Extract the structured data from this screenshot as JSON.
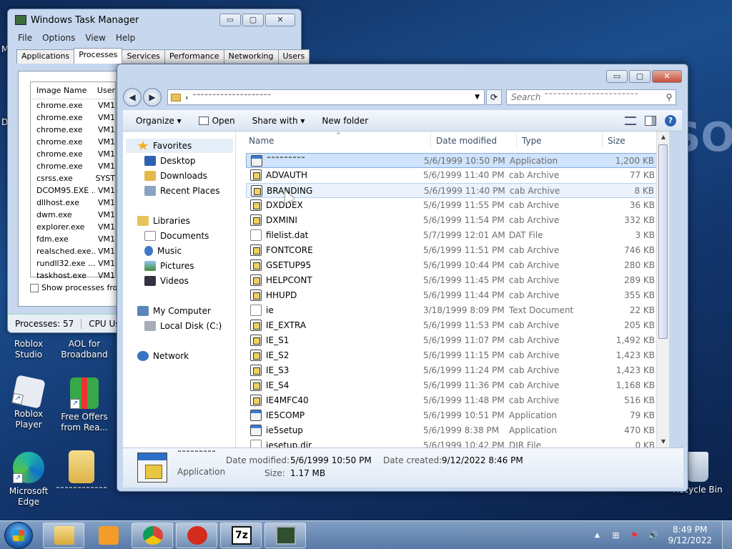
{
  "desktop": {
    "deco_text": "SO",
    "partial_left_1": "M",
    "partial_left_2": "D",
    "icons": [
      {
        "label": "Roblox Studio"
      },
      {
        "label": "AOL for Broadband"
      },
      {
        "label": "Roblox Player"
      },
      {
        "label": "Free Offers from Rea..."
      },
      {
        "label": "Microsoft Edge"
      },
      {
        "label": "˜˜˜˜˜˜˜˜˜˜˜˜"
      },
      {
        "label": "Recycle Bin"
      }
    ]
  },
  "taskmgr": {
    "title": "Windows Task Manager",
    "btn_min": "▭",
    "btn_max": "▢",
    "btn_close": "✕",
    "menu": [
      "File",
      "Options",
      "View",
      "Help"
    ],
    "tabs": [
      "Applications",
      "Processes",
      "Services",
      "Performance",
      "Networking",
      "Users"
    ],
    "active_tab": 1,
    "col_image": "Image Name",
    "col_user": "User",
    "rows": [
      {
        "name": "chrome.exe",
        "user": "VM1"
      },
      {
        "name": "chrome.exe",
        "user": "VM1"
      },
      {
        "name": "chrome.exe",
        "user": "VM1"
      },
      {
        "name": "chrome.exe",
        "user": "VM1"
      },
      {
        "name": "chrome.exe",
        "user": "VM1"
      },
      {
        "name": "chrome.exe",
        "user": "VM1"
      },
      {
        "name": "csrss.exe",
        "user": "SYST"
      },
      {
        "name": "DCOM95.EXE ...",
        "user": "VM1"
      },
      {
        "name": "dllhost.exe",
        "user": "VM1"
      },
      {
        "name": "dwm.exe",
        "user": "VM1"
      },
      {
        "name": "explorer.exe",
        "user": "VM1"
      },
      {
        "name": "fdm.exe",
        "user": "VM1"
      },
      {
        "name": "realsched.exe...",
        "user": "VM1"
      },
      {
        "name": "rundll32.exe ...",
        "user": "VM1"
      },
      {
        "name": "taskhost.exe",
        "user": "VM1"
      }
    ],
    "show_all": "Show processes from",
    "status_processes": "Processes: 57",
    "status_cpu": "CPU Us"
  },
  "explorer": {
    "btn_min": "▭",
    "btn_max": "▢",
    "btn_close": "✕",
    "address_path": "˜˜˜˜˜˜˜˜˜˜˜˜˜˜˜˜˜˜˜˜",
    "address_arrow": "›",
    "address_dropdown": "▼",
    "refresh": "⟳",
    "search_placeholder": "Search ˜˜˜˜˜˜˜˜˜˜˜˜˜˜˜˜˜˜˜˜˜˜",
    "search_icon": "⚲",
    "back": "◀",
    "forward": "▶",
    "toolbar": {
      "organize": "Organize ▾",
      "open": "Open",
      "share": "Share with ▾",
      "new_folder": "New folder",
      "help": "?"
    },
    "nav": {
      "favorites": "Favorites",
      "desktop": "Desktop",
      "downloads": "Downloads",
      "recent": "Recent Places",
      "libraries": "Libraries",
      "documents": "Documents",
      "music": "Music",
      "pictures": "Pictures",
      "videos": "Videos",
      "computer": "My Computer",
      "local_disk": "Local Disk (C:)",
      "network": "Network"
    },
    "columns": {
      "name": "Name",
      "date": "Date modified",
      "type": "Type",
      "size": "Size"
    },
    "files": [
      {
        "name": "˜˜˜˜˜˜˜˜˜",
        "date": "5/6/1999 10:50 PM",
        "type": "Application",
        "size": "1,200 KB",
        "kind": "app",
        "state": "selected"
      },
      {
        "name": "ADVAUTH",
        "date": "5/6/1999 11:40 PM",
        "type": "cab Archive",
        "size": "77 KB",
        "kind": "cab",
        "state": ""
      },
      {
        "name": "BRANDING",
        "date": "5/6/1999 11:40 PM",
        "type": "cab Archive",
        "size": "8 KB",
        "kind": "cab",
        "state": "hover"
      },
      {
        "name": "DXDDEX",
        "date": "5/6/1999 11:55 PM",
        "type": "cab Archive",
        "size": "36 KB",
        "kind": "cab",
        "state": ""
      },
      {
        "name": "DXMINI",
        "date": "5/6/1999 11:54 PM",
        "type": "cab Archive",
        "size": "332 KB",
        "kind": "cab",
        "state": ""
      },
      {
        "name": "filelist.dat",
        "date": "5/7/1999 12:01 AM",
        "type": "DAT File",
        "size": "3 KB",
        "kind": "doc",
        "state": ""
      },
      {
        "name": "FONTCORE",
        "date": "5/6/1999 11:51 PM",
        "type": "cab Archive",
        "size": "746 KB",
        "kind": "cab",
        "state": ""
      },
      {
        "name": "GSETUP95",
        "date": "5/6/1999 10:44 PM",
        "type": "cab Archive",
        "size": "280 KB",
        "kind": "cab",
        "state": ""
      },
      {
        "name": "HELPCONT",
        "date": "5/6/1999 11:45 PM",
        "type": "cab Archive",
        "size": "289 KB",
        "kind": "cab",
        "state": ""
      },
      {
        "name": "HHUPD",
        "date": "5/6/1999 11:44 PM",
        "type": "cab Archive",
        "size": "355 KB",
        "kind": "cab",
        "state": ""
      },
      {
        "name": "ie",
        "date": "3/18/1999 8:09 PM",
        "type": "Text Document",
        "size": "22 KB",
        "kind": "doc",
        "state": ""
      },
      {
        "name": "IE_EXTRA",
        "date": "5/6/1999 11:53 PM",
        "type": "cab Archive",
        "size": "205 KB",
        "kind": "cab",
        "state": ""
      },
      {
        "name": "IE_S1",
        "date": "5/6/1999 11:07 PM",
        "type": "cab Archive",
        "size": "1,492 KB",
        "kind": "cab",
        "state": ""
      },
      {
        "name": "IE_S2",
        "date": "5/6/1999 11:15 PM",
        "type": "cab Archive",
        "size": "1,423 KB",
        "kind": "cab",
        "state": ""
      },
      {
        "name": "IE_S3",
        "date": "5/6/1999 11:24 PM",
        "type": "cab Archive",
        "size": "1,423 KB",
        "kind": "cab",
        "state": ""
      },
      {
        "name": "IE_S4",
        "date": "5/6/1999 11:36 PM",
        "type": "cab Archive",
        "size": "1,168 KB",
        "kind": "cab",
        "state": ""
      },
      {
        "name": "IE4MFC40",
        "date": "5/6/1999 11:48 PM",
        "type": "cab Archive",
        "size": "516 KB",
        "kind": "cab",
        "state": ""
      },
      {
        "name": "IE5COMP",
        "date": "5/6/1999 10:51 PM",
        "type": "Application",
        "size": "79 KB",
        "kind": "app",
        "state": ""
      },
      {
        "name": "ie5setup",
        "date": "5/6/1999 8:38 PM",
        "type": "Application",
        "size": "470 KB",
        "kind": "app",
        "state": ""
      },
      {
        "name": "iesetup.dir",
        "date": "5/6/1999 10:42 PM",
        "type": "DIR File",
        "size": "0 KB",
        "kind": "doc",
        "state": ""
      }
    ],
    "details": {
      "name": "˜˜˜˜˜˜˜˜˜",
      "kind": "Application",
      "modified_label": "Date modified:",
      "modified": "5/6/1999 10:50 PM",
      "created_label": "Date created:",
      "created": "9/12/2022 8:46 PM",
      "size_label": "Size:",
      "size": "1.17 MB"
    }
  },
  "taskbar": {
    "tray_up": "▲",
    "tray_net": "⊞",
    "tray_flag": "⚑",
    "tray_vol": "🔊",
    "time": "8:49 PM",
    "date": "9/12/2022",
    "sevenzip": "7z"
  }
}
